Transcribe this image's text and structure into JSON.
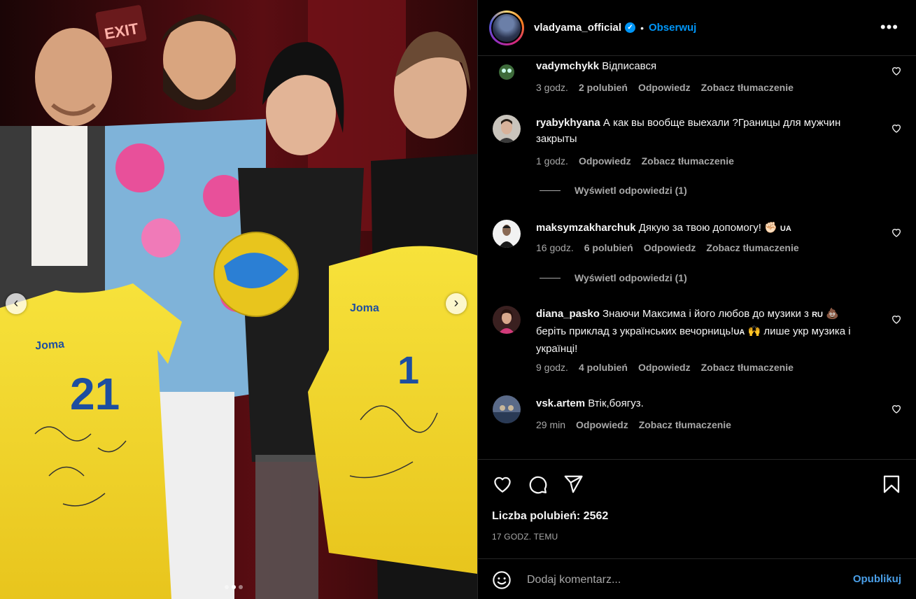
{
  "post": {
    "owner": "vladyama_official",
    "follow_label": "Obserwuj",
    "separator": "•",
    "more_label": "•••",
    "likes_text": "Liczba polubień: 2562",
    "time_ago": "17 GODZ. TEMU",
    "carousel": {
      "active_index": 1,
      "total": 3,
      "prev_label": "‹",
      "next_label": "›"
    }
  },
  "comments": [
    {
      "user": "vadymchykk",
      "text": "Відписався",
      "time": "3 godz.",
      "likes": "2 polubień",
      "reply": "Odpowiedz",
      "translate": "Zobacz tłumaczenie"
    },
    {
      "user": "ryabykhyana",
      "text": "А как вы вообще выехали ?Границы для мужчин закрыты",
      "time": "1 godz.",
      "likes": "",
      "reply": "Odpowiedz",
      "translate": "Zobacz tłumaczenie",
      "view_replies": "Wyświetl odpowiedzi (1)"
    },
    {
      "user": "maksymzakharchuk",
      "text": "Дякую за твою допомогу! ✊🏻",
      "flag": "UA",
      "time": "16 godz.",
      "likes": "6 polubień",
      "reply": "Odpowiedz",
      "translate": "Zobacz tłumaczenie",
      "view_replies": "Wyświetl odpowiedzi (1)"
    },
    {
      "user": "diana_pasko",
      "text_a": "Знаючи Максима і його любов до музики з",
      "flag_a": "RU",
      "text_b": "💩 беріть приклад з українських вечорниць!",
      "flag_b": "UA",
      "text_c": "🙌 лише укр музика і українці!",
      "time": "9 godz.",
      "likes": "4 polubień",
      "reply": "Odpowiedz",
      "translate": "Zobacz tłumaczenie"
    },
    {
      "user": "vsk.artem",
      "text": "Втік,боягуз.",
      "time": "29 min",
      "likes": "",
      "reply": "Odpowiedz",
      "translate": "Zobacz tłumaczenie"
    }
  ],
  "add_comment": {
    "placeholder": "Dodaj komentarz...",
    "publish_label": "Opublikuj"
  },
  "icons": {
    "like": "heart-icon",
    "comment": "speech-bubble-icon",
    "share": "paper-plane-icon",
    "save": "bookmark-icon",
    "emoji": "smiley-icon",
    "verified": "verified-badge-icon"
  },
  "colors": {
    "link_blue": "#0095f6",
    "muted_text": "#a8a8a8",
    "background": "#000000",
    "divider": "#262626"
  },
  "photo": {
    "sign_text": "EXIT",
    "jersey_brand": "Joma",
    "jersey_numbers": [
      "21",
      "1"
    ]
  }
}
